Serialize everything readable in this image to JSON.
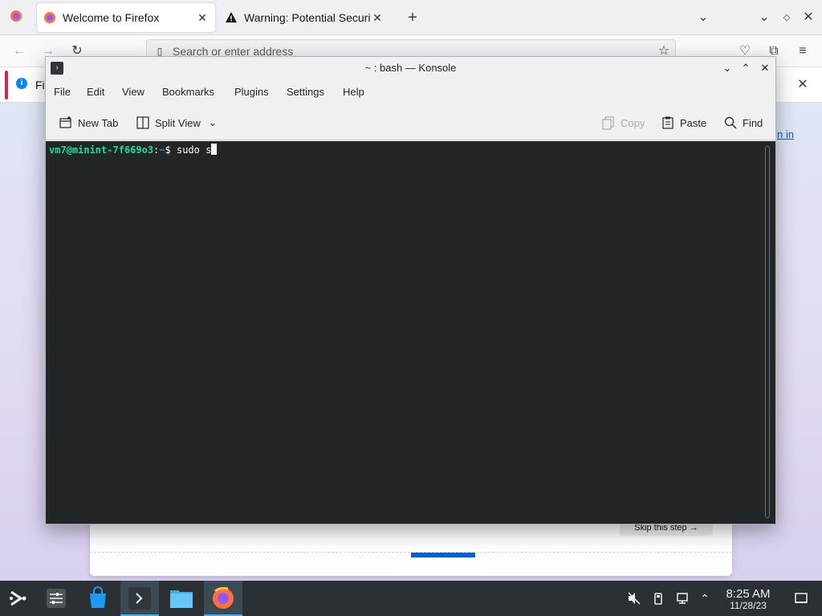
{
  "firefox": {
    "tabs": [
      {
        "title": "Welcome to Firefox",
        "active": true
      },
      {
        "title": "Warning: Potential Security",
        "active": false
      }
    ],
    "address_placeholder": "Search or enter address",
    "notice_text": "Fi",
    "skip_label": "Skip this step →",
    "signin_fragment": "n in",
    "progress_fraction": [
      0.5,
      0.6
    ]
  },
  "konsole": {
    "title": "~ : bash — Konsole",
    "menu": [
      "File",
      "Edit",
      "View",
      "Bookmarks",
      "Plugins",
      "Settings",
      "Help"
    ],
    "toolbar": {
      "new_tab": "New Tab",
      "split_view": "Split View",
      "copy": "Copy",
      "paste": "Paste",
      "find": "Find"
    },
    "prompt_user": "vm7@minint-7f669o3",
    "prompt_sep": ":",
    "prompt_path": "~",
    "prompt_symbol": "$",
    "command": " sudo s"
  },
  "taskbar": {
    "apps": [
      "application-launcher-icon",
      "system-settings-icon",
      "discover-store-icon",
      "konsole-icon",
      "dolphin-files-icon",
      "firefox-icon"
    ],
    "time": "8:25 AM",
    "date": "11/28/23"
  },
  "colors": {
    "accent": "#3daee9",
    "terminal_bg": "#232627",
    "prompt_user": "#1cdc9a",
    "prompt_path": "#1d99f3"
  }
}
